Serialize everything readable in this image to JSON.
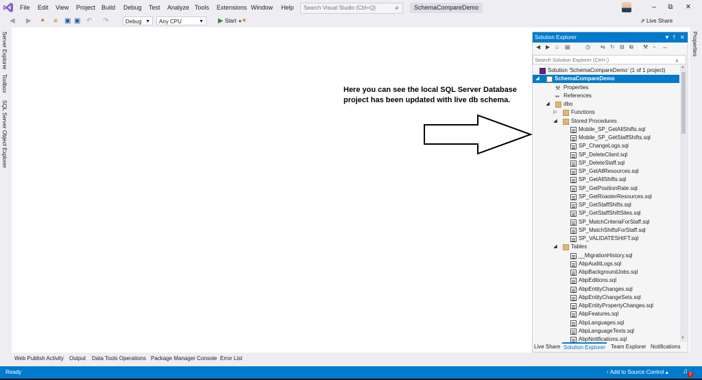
{
  "menu": [
    "File",
    "Edit",
    "View",
    "Project",
    "Build",
    "Debug",
    "Test",
    "Analyze",
    "Tools",
    "Extensions",
    "Window",
    "Help"
  ],
  "search": {
    "placeholder": "Search Visual Studio (Ctrl+Q)"
  },
  "project_title": "SchemaCompareDemo",
  "toolbar": {
    "config": "Debug",
    "platform": "Any CPU",
    "start": "Start",
    "live_share": "Live Share"
  },
  "left_rail": [
    "Server Explorer",
    "Toolbox",
    "SQL Server Object Explorer"
  ],
  "right_rail": "Properties",
  "annotation": "Here you can see the local SQL Server Database project has been updated with live db schema.",
  "solution_explorer": {
    "title": "Solution Explorer",
    "search_placeholder": "Search Solution Explorer (Ctrl+;)",
    "tree": [
      {
        "label": "Solution 'SchemaCompareDemo' (1 of 1 project)",
        "type": "solution",
        "level": 0,
        "expander": ""
      },
      {
        "label": "SchemaCompareDemo",
        "type": "project",
        "level": 0,
        "expander": "expanded",
        "selected": true
      },
      {
        "label": "Properties",
        "type": "wrench",
        "level": 1,
        "expander": ""
      },
      {
        "label": "References",
        "type": "refs",
        "level": 1,
        "expander": ""
      },
      {
        "label": "dbo",
        "type": "folder",
        "level": 1,
        "expander": "expanded"
      },
      {
        "label": "Functions",
        "type": "folder",
        "level": 2,
        "expander": "collapsed"
      },
      {
        "label": "Stored Procedures",
        "type": "folder",
        "level": 2,
        "expander": "expanded"
      },
      {
        "label": "Mobile_SP_GetAllShifts.sql",
        "type": "file",
        "level": 3,
        "expander": ""
      },
      {
        "label": "Mobile_SP_GetStaffShifts.sql",
        "type": "file",
        "level": 3,
        "expander": ""
      },
      {
        "label": "SP_ChangeLogs.sql",
        "type": "file",
        "level": 3,
        "expander": ""
      },
      {
        "label": "SP_DeleteClient.sql",
        "type": "file",
        "level": 3,
        "expander": ""
      },
      {
        "label": "SP_DeleteStaff.sql",
        "type": "file",
        "level": 3,
        "expander": ""
      },
      {
        "label": "SP_GetAllResources.sql",
        "type": "file",
        "level": 3,
        "expander": ""
      },
      {
        "label": "SP_GetAllShifts.sql",
        "type": "file",
        "level": 3,
        "expander": ""
      },
      {
        "label": "SP_GetPositionRate.sql",
        "type": "file",
        "level": 3,
        "expander": ""
      },
      {
        "label": "SP_GetRoasterResources.sql",
        "type": "file",
        "level": 3,
        "expander": ""
      },
      {
        "label": "SP_GetStaffShifts.sql",
        "type": "file",
        "level": 3,
        "expander": ""
      },
      {
        "label": "SP_GetStaffShiftSites.sql",
        "type": "file",
        "level": 3,
        "expander": ""
      },
      {
        "label": "SP_MatchCriteriaForStaff.sql",
        "type": "file",
        "level": 3,
        "expander": ""
      },
      {
        "label": "SP_MatchShiftsForStaff.sql",
        "type": "file",
        "level": 3,
        "expander": ""
      },
      {
        "label": "SP_VALIDATESHIFT.sql",
        "type": "file",
        "level": 3,
        "expander": ""
      },
      {
        "label": "Tables",
        "type": "folder",
        "level": 2,
        "expander": "expanded"
      },
      {
        "label": "__MigrationHistory.sql",
        "type": "file",
        "level": 3,
        "expander": ""
      },
      {
        "label": "AbpAuditLogs.sql",
        "type": "file",
        "level": 3,
        "expander": ""
      },
      {
        "label": "AbpBackgroundJobs.sql",
        "type": "file",
        "level": 3,
        "expander": ""
      },
      {
        "label": "AbpEditions.sql",
        "type": "file",
        "level": 3,
        "expander": ""
      },
      {
        "label": "AbpEntityChanges.sql",
        "type": "file",
        "level": 3,
        "expander": ""
      },
      {
        "label": "AbpEntityChangeSets.sql",
        "type": "file",
        "level": 3,
        "expander": ""
      },
      {
        "label": "AbpEntityPropertyChanges.sql",
        "type": "file",
        "level": 3,
        "expander": ""
      },
      {
        "label": "AbpFeatures.sql",
        "type": "file",
        "level": 3,
        "expander": ""
      },
      {
        "label": "AbpLanguages.sql",
        "type": "file",
        "level": 3,
        "expander": ""
      },
      {
        "label": "AbpLanguageTexts.sql",
        "type": "file",
        "level": 3,
        "expander": ""
      },
      {
        "label": "AbpNotifications.sql",
        "type": "file",
        "level": 3,
        "expander": ""
      }
    ],
    "bottom_tabs": [
      "Live Share",
      "Solution Explorer",
      "Team Explorer",
      "Notifications"
    ]
  },
  "tool_tabs": [
    "Web Publish Activity",
    "Output",
    "Data Tools Operations",
    "Package Manager Console",
    "Error List"
  ],
  "status": {
    "ready": "Ready",
    "source_control": "Add to Source Control",
    "notification_count": "2"
  },
  "colors": {
    "accent": "#007acc",
    "chrome": "#eeeef2",
    "vs_purple": "#68217a"
  }
}
